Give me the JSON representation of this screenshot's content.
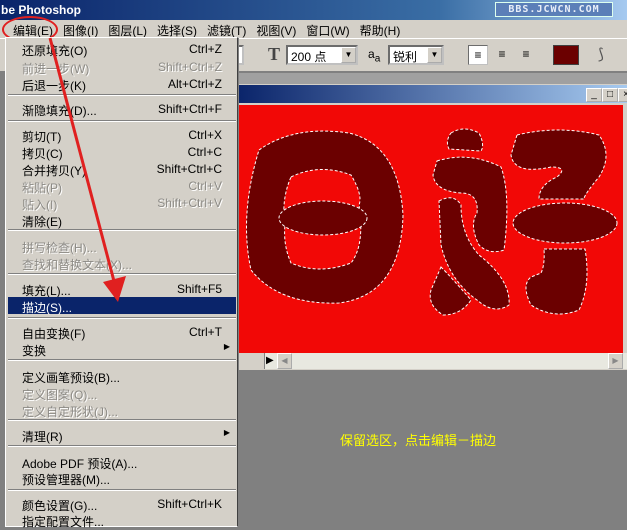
{
  "app_title": "be Photoshop",
  "watermark": "BBS.JCWCN.COM",
  "menubar": [
    "编辑(E)",
    "图像(I)",
    "图层(L)",
    "选择(S)",
    "滤镜(T)",
    "视图(V)",
    "窗口(W)",
    "帮助(H)"
  ],
  "toolbar": {
    "font_size": "200 点",
    "antialias": "锐利",
    "color": "#6b0000"
  },
  "edit_menu": [
    {
      "label": "还原填充(O)",
      "shortcut": "Ctrl+Z",
      "enabled": true
    },
    {
      "label": "前进一步(W)",
      "shortcut": "Shift+Ctrl+Z",
      "enabled": false
    },
    {
      "label": "后退一步(K)",
      "shortcut": "Alt+Ctrl+Z",
      "enabled": true
    },
    {
      "label": "渐隐填充(D)...",
      "shortcut": "Shift+Ctrl+F",
      "enabled": true
    },
    {
      "label": "剪切(T)",
      "shortcut": "Ctrl+X",
      "enabled": true
    },
    {
      "label": "拷贝(C)",
      "shortcut": "Ctrl+C",
      "enabled": true
    },
    {
      "label": "合并拷贝(Y)",
      "shortcut": "Shift+Ctrl+C",
      "enabled": true
    },
    {
      "label": "粘贴(P)",
      "shortcut": "Ctrl+V",
      "enabled": false
    },
    {
      "label": "贴入(I)",
      "shortcut": "Shift+Ctrl+V",
      "enabled": false
    },
    {
      "label": "清除(E)",
      "shortcut": "",
      "enabled": true
    },
    {
      "label": "拼写检查(H)...",
      "shortcut": "",
      "enabled": false
    },
    {
      "label": "查找和替换文本(X)...",
      "shortcut": "",
      "enabled": false
    },
    {
      "label": "填充(L)...",
      "shortcut": "Shift+F5",
      "enabled": true
    },
    {
      "label": "描边(S)...",
      "shortcut": "",
      "enabled": true,
      "highlighted": true
    },
    {
      "label": "自由变换(F)",
      "shortcut": "Ctrl+T",
      "enabled": true
    },
    {
      "label": "变换",
      "shortcut": "",
      "enabled": true,
      "submenu": true
    },
    {
      "label": "定义画笔预设(B)...",
      "shortcut": "",
      "enabled": true
    },
    {
      "label": "定义图案(Q)...",
      "shortcut": "",
      "enabled": false
    },
    {
      "label": "定义自定形状(J)...",
      "shortcut": "",
      "enabled": false
    },
    {
      "label": "清理(R)",
      "shortcut": "",
      "enabled": true,
      "submenu": true
    },
    {
      "label": "Adobe PDF 预设(A)...",
      "shortcut": "",
      "enabled": true
    },
    {
      "label": "预设管理器(M)...",
      "shortcut": "",
      "enabled": true
    },
    {
      "label": "颜色设置(G)...",
      "shortcut": "Shift+Ctrl+K",
      "enabled": true
    },
    {
      "label": "指定配置文件...",
      "shortcut": "",
      "enabled": true
    }
  ],
  "caption": "保留选区，点击编辑－描边",
  "colors": {
    "canvas": "#f20806",
    "text_fill": "#6b0000",
    "highlight": "#0a246a",
    "annotation": "#e02020"
  }
}
